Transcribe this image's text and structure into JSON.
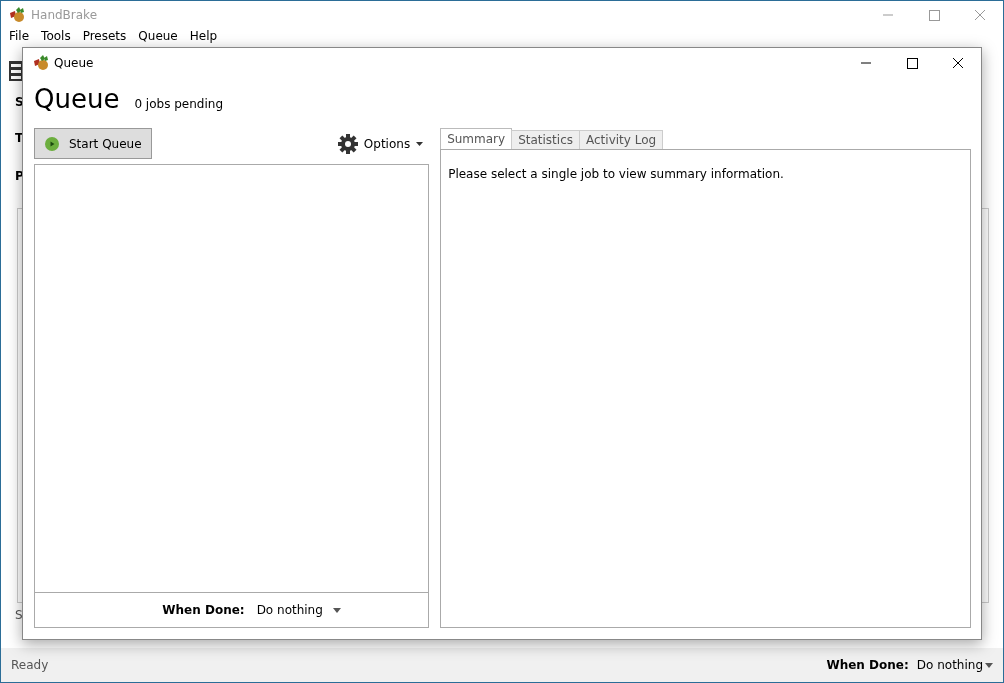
{
  "main_window": {
    "title": "HandBrake",
    "menu": [
      "File",
      "Tools",
      "Presets",
      "Queue",
      "Help"
    ],
    "side_labels": [
      "S",
      "T",
      "P",
      "S"
    ],
    "status": "Ready",
    "when_done_label": "When Done:",
    "when_done_value": "Do nothing"
  },
  "queue_dialog": {
    "title": "Queue",
    "heading": "Queue",
    "jobs_pending": "0 jobs pending",
    "start_button": "Start Queue",
    "options_button": "Options",
    "tabs": [
      {
        "label": "Summary",
        "selected": true
      },
      {
        "label": "Statistics",
        "selected": false
      },
      {
        "label": "Activity Log",
        "selected": false
      }
    ],
    "summary_text": "Please select a single job to view summary information.",
    "when_done_label": "When Done:",
    "when_done_value": "Do nothing"
  }
}
